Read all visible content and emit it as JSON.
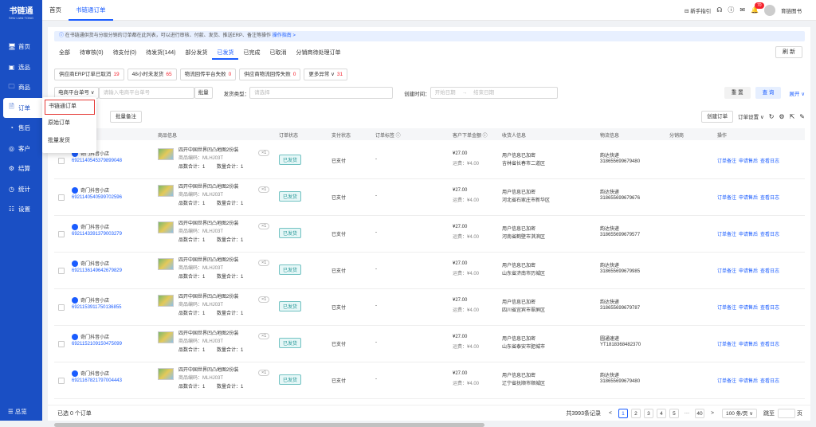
{
  "sidebar": {
    "logo": "书链通",
    "logo_sub": "SHU LIAN TONG",
    "items": [
      {
        "icon": "🖥",
        "label": "首页"
      },
      {
        "icon": "▣",
        "label": "选品"
      },
      {
        "icon": "🗀",
        "label": "商品"
      },
      {
        "icon": "🗎",
        "label": "订单"
      },
      {
        "icon": "◔",
        "label": "售后"
      },
      {
        "icon": "◎",
        "label": "客户"
      },
      {
        "icon": "⚙",
        "label": "结算"
      },
      {
        "icon": "◷",
        "label": "统计"
      },
      {
        "icon": "☷",
        "label": "设置"
      }
    ],
    "bottom": "☰ 总览"
  },
  "topbar": {
    "tabs": [
      "首页",
      "书链通订单"
    ],
    "guide": "新手指引",
    "badge": "70",
    "user": "育链图书"
  },
  "notice": {
    "text": "在书链通供货与分级分销的订单都在此列表，可以进行审核、付款、发货、推送ERP、备注等操作",
    "link": "操作指南 >"
  },
  "status_tabs": [
    "全部",
    "待审核(0)",
    "待支付(0)",
    "待发货(144)",
    "部分发货",
    "已发货",
    "已完成",
    "已取消",
    "分销商待处理订单"
  ],
  "refresh": "刷 新",
  "chips": [
    {
      "label": "供应商ERP订单已取消",
      "n": "19"
    },
    {
      "label": "48小时未发货",
      "n": "65"
    },
    {
      "label": "物流回传平台失败",
      "n": "0"
    },
    {
      "label": "供应商物流回传失败",
      "n": "0"
    },
    {
      "label": "更多异常 ∨",
      "n": "31"
    }
  ],
  "filters": {
    "select": "电商平台单号 ∨",
    "input": "请输入电商平台单号",
    "batch": "批量",
    "ship_type": "发货类型：",
    "ship_ph": "请选择",
    "create_time": "创建时间：",
    "start": "开始日期",
    "arrow": "→",
    "end": "结束日期",
    "reset": "重 置",
    "query": "查 询",
    "expand": "展开 ∨"
  },
  "toolbar": {
    "batch_note": "批量备注",
    "create": "创建订单",
    "settings": "订单设置 ∨"
  },
  "table": {
    "headers": [
      "商品信息",
      "订单状态",
      "支付状态",
      "订单标签 ⓘ",
      "客户下单金额 ⓘ",
      "收货人信息",
      "物流信息",
      "分销商",
      "操作"
    ]
  },
  "product": {
    "title": "四开中国世界凹凸地图2份装",
    "code": "商品编码：MLHJ03T",
    "qty": "×1",
    "single": "品数合计：1",
    "total": "数量合计：1"
  },
  "rows": [
    {
      "shop": "奇门抖音小店",
      "no": "6921140545379899048",
      "status": "已发货",
      "pay": "已支付",
      "tag": "-",
      "amount": "¥27.00",
      "freight": "运费：¥4.00",
      "recv1": "用户信息已加密",
      "recv2": "吉林省长春市二道区",
      "ex": "韵达快递",
      "track": "318655699679480",
      "act": [
        "订单备注",
        "申请售后",
        "查看日志"
      ]
    },
    {
      "shop": "奇门抖音小店",
      "no": "6921140540599702596",
      "status": "已发货",
      "pay": "已支付",
      "tag": "-",
      "amount": "¥27.00",
      "freight": "运费：¥4.00",
      "recv1": "用户信息已加密",
      "recv2": "河北省石家庄市新华区",
      "ex": "韵达快递",
      "track": "318655699679676",
      "act": [
        "订单备注",
        "申请售后",
        "查看日志"
      ]
    },
    {
      "shop": "奇门抖音小店",
      "no": "6921143391379003279",
      "status": "已发货",
      "pay": "已支付",
      "tag": "-",
      "amount": "¥27.00",
      "freight": "运费：¥4.00",
      "recv1": "用户信息已加密",
      "recv2": "河南省鹤壁市淇滨区",
      "ex": "韵达快递",
      "track": "318655699679577",
      "act": [
        "订单备注",
        "申请售后",
        "查看日志"
      ]
    },
    {
      "shop": "奇门抖音小店",
      "no": "6921136149642679829",
      "status": "已发货",
      "pay": "已支付",
      "tag": "-",
      "amount": "¥27.00",
      "freight": "运费：¥4.00",
      "recv1": "用户信息已加密",
      "recv2": "山东省济南市历城区",
      "ex": "韵达快递",
      "track": "318655699679985",
      "act": [
        "订单备注",
        "申请售后",
        "查看日志"
      ]
    },
    {
      "shop": "奇门抖音小店",
      "no": "6921153911750136855",
      "status": "已发货",
      "pay": "已支付",
      "tag": "-",
      "amount": "¥27.00",
      "freight": "运费：¥4.00",
      "recv1": "用户信息已加密",
      "recv2": "四川省宜宾市翠屏区",
      "ex": "韵达快递",
      "track": "318655699679787",
      "act": [
        "订单备注",
        "申请售后",
        "查看日志"
      ]
    },
    {
      "shop": "奇门抖音小店",
      "no": "6921152109150475099",
      "status": "已发货",
      "pay": "已支付",
      "tag": "-",
      "amount": "¥27.00",
      "freight": "运费：¥4.00",
      "recv1": "用户信息已加密",
      "recv2": "山东省泰安市肥城市",
      "ex": "圆通速递",
      "track": "YT1818368482370",
      "act": [
        "订单备注",
        "申请售后",
        "查看日志"
      ]
    },
    {
      "shop": "奇门抖音小店",
      "no": "6921167821797004443",
      "status": "已发货",
      "pay": "已支付",
      "tag": "-",
      "amount": "¥27.00",
      "freight": "运费：¥4.00",
      "recv1": "用户信息已加密",
      "recv2": "辽宁省抚顺市顺城区",
      "ex": "韵达快递",
      "track": "318655699679480",
      "act": [
        "订单备注",
        "申请售后",
        "查看日志"
      ]
    }
  ],
  "dropdown": [
    "书链通订单",
    "原始订单",
    "批量发货"
  ],
  "footer": {
    "selected": "已选 0 个订单",
    "total": "共3993条记录",
    "pages": [
      "1",
      "2",
      "3",
      "4",
      "5",
      "···",
      "40"
    ],
    "prev": "<",
    "next": ">",
    "size": "100 条/页 ∨",
    "goto": "跳至",
    "page_unit": "页"
  }
}
